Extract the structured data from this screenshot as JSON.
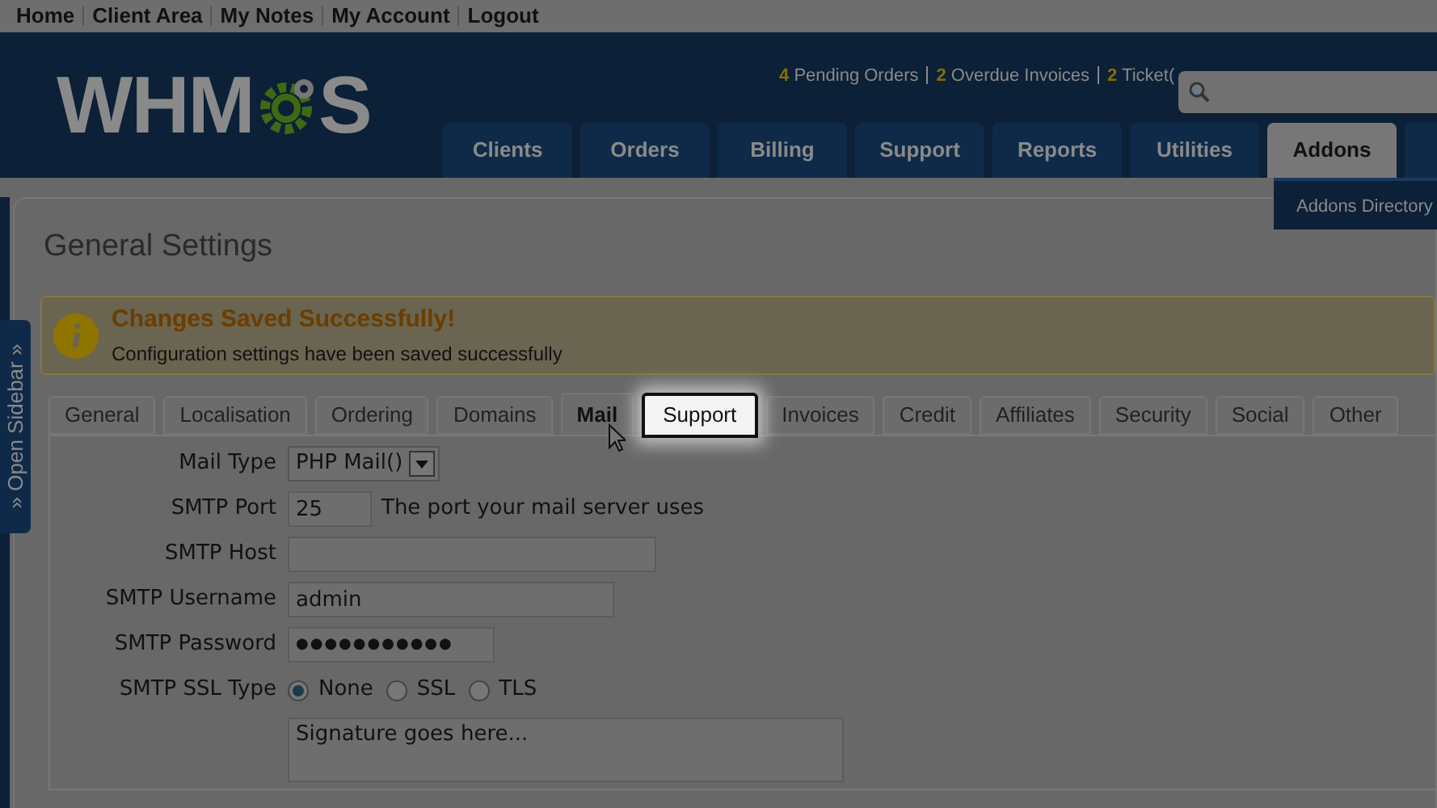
{
  "top_links": [
    "Home",
    "Client Area",
    "My Notes",
    "My Account",
    "Logout"
  ],
  "header": {
    "logo": [
      "WHM",
      "S"
    ],
    "alerts": [
      {
        "count": "4",
        "label": "Pending Orders"
      },
      {
        "count": "2",
        "label": "Overdue Invoices"
      },
      {
        "count": "2",
        "label": "Ticket("
      }
    ],
    "nav": [
      {
        "label": "Clients",
        "selected": false
      },
      {
        "label": "Orders",
        "selected": false
      },
      {
        "label": "Billing",
        "selected": false
      },
      {
        "label": "Support",
        "selected": false
      },
      {
        "label": "Reports",
        "selected": false
      },
      {
        "label": "Utilities",
        "selected": false
      },
      {
        "label": "Addons",
        "selected": true
      }
    ],
    "dropdown": [
      "Addons Directory"
    ]
  },
  "sidebar_toggle": "» Open Sidebar »",
  "page_title": "General Settings",
  "notice": {
    "title": "Changes Saved Successfully!",
    "message": "Configuration settings have been saved successfully"
  },
  "tabs": [
    {
      "label": "General",
      "selected": false,
      "highlighted": false
    },
    {
      "label": "Localisation",
      "selected": false,
      "highlighted": false
    },
    {
      "label": "Ordering",
      "selected": false,
      "highlighted": false
    },
    {
      "label": "Domains",
      "selected": false,
      "highlighted": false
    },
    {
      "label": "Mail",
      "selected": true,
      "highlighted": false
    },
    {
      "label": "Support",
      "selected": false,
      "highlighted": true
    },
    {
      "label": "Invoices",
      "selected": false,
      "highlighted": false
    },
    {
      "label": "Credit",
      "selected": false,
      "highlighted": false
    },
    {
      "label": "Affiliates",
      "selected": false,
      "highlighted": false
    },
    {
      "label": "Security",
      "selected": false,
      "highlighted": false
    },
    {
      "label": "Social",
      "selected": false,
      "highlighted": false
    },
    {
      "label": "Other",
      "selected": false,
      "highlighted": false
    }
  ],
  "form": [
    {
      "kind": "select",
      "label": "Mail Type",
      "value": "PHP Mail()"
    },
    {
      "kind": "text",
      "label": "SMTP Port",
      "value": "25",
      "hint": "The port your mail server uses"
    },
    {
      "kind": "text",
      "label": "SMTP Host"
    },
    {
      "kind": "text",
      "label": "SMTP Username",
      "value": "admin"
    },
    {
      "kind": "password",
      "label": "SMTP Password",
      "value": "●●●●●●●●●●●"
    },
    {
      "kind": "radio",
      "label": "SMTP SSL Type",
      "options": [
        {
          "label": "None",
          "selected": true
        },
        {
          "label": "SSL",
          "selected": false
        },
        {
          "label": "TLS",
          "selected": false
        }
      ]
    },
    {
      "kind": "textarea",
      "value": "Signature goes here..."
    }
  ]
}
